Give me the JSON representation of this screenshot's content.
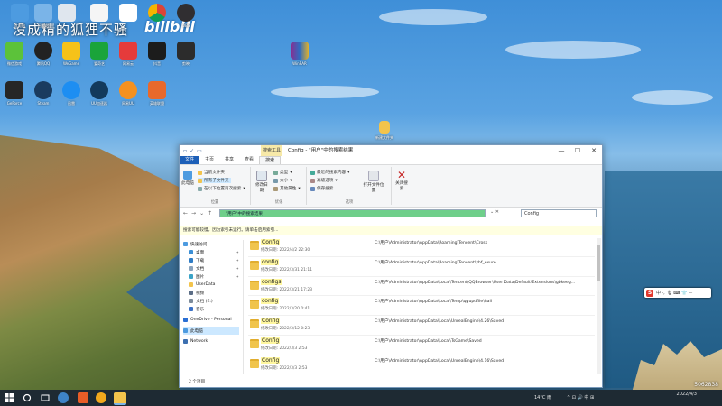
{
  "desktop": {
    "watermark": "没成精的狐狸不骚",
    "bilibili": "bilibili",
    "icons": [
      {
        "label": "此电脑"
      },
      {
        "label": "回收站"
      },
      {
        "label": ""
      },
      {
        "label": ""
      },
      {
        "label": ""
      },
      {
        "label": ""
      },
      {
        "label": "OBS"
      },
      {
        "label": "微信游戏"
      },
      {
        "label": "腾讯QQ"
      },
      {
        "label": "WeGame"
      },
      {
        "label": "爱奇艺"
      },
      {
        "label": "网易云"
      },
      {
        "label": "抖音"
      },
      {
        "label": "剪映"
      },
      {
        "label": "GeForce"
      },
      {
        "label": "Steam"
      },
      {
        "label": "迅雷"
      },
      {
        "label": "UU加速器"
      },
      {
        "label": "网易UU"
      },
      {
        "label": "英雄联盟"
      },
      {
        "label": "WinRAR"
      },
      {
        "label": "新建文件夹"
      }
    ]
  },
  "window": {
    "quick_access": [
      "▫",
      "✓",
      "▭"
    ],
    "context_tab": "搜索工具",
    "title": "Config - \"用户\"中的搜索结果",
    "controls": [
      "—",
      "☐",
      "✕"
    ],
    "tabs": [
      "文件",
      "主页",
      "共享",
      "查看",
      "搜索"
    ],
    "ribbon": {
      "btn_this_pc": "此电脑",
      "current_folder": "当前文件夹",
      "all_subfolders": "所有子文件夹",
      "search_again": "在以下位置再次搜索",
      "group_location": "位置",
      "btn_modified": "修改日期",
      "kind": "类型",
      "size": "大小",
      "other_props": "其他属性",
      "group_refine": "优化",
      "recent_searches": "最近的搜索内容",
      "advanced": "高级选项",
      "save_search": "保存搜索",
      "btn_open_location": "打开文件位置",
      "group_options": "选项",
      "btn_close_search": "关闭搜索"
    },
    "address": "\"用户\"中的搜索结果",
    "search_value": "Config",
    "info": "搜索可能较慢，因为索引未运行。请单击启用索引...",
    "nav": [
      {
        "label": "快速访问",
        "pin": false
      },
      {
        "label": "桌面",
        "pin": true
      },
      {
        "label": "下载",
        "pin": true
      },
      {
        "label": "文档",
        "pin": true
      },
      {
        "label": "图片",
        "pin": true
      },
      {
        "label": "UserData",
        "pin": false
      },
      {
        "label": "视频",
        "pin": false
      },
      {
        "label": "文档 (E:)",
        "pin": false
      },
      {
        "label": "音乐",
        "pin": false
      },
      {
        "label": "OneDrive - Personal",
        "pin": false
      },
      {
        "label": "此电脑",
        "pin": false,
        "selected": true
      },
      {
        "label": "Network",
        "pin": false
      }
    ],
    "results": [
      {
        "name": "Config",
        "date": "修改日期: 2022/4/2 22:30",
        "path": "C:\\用户\\Administrator\\AppData\\Roaming\\Tencent\\Cross"
      },
      {
        "name": "config",
        "date": "修改日期: 2022/3/31 21:11",
        "path": "C:\\用户\\Administrator\\AppData\\Roaming\\Tencent\\zhf_exure"
      },
      {
        "name": "configs",
        "date": "修改日期: 2022/3/21 17:23",
        "path": "C:\\用户\\Administrator\\AppData\\Local\\Tencent\\QQBrowser\\User Data\\Default\\Extensions\\gbkeeg..."
      },
      {
        "name": "config",
        "date": "修改日期: 2022/3/20 0:41",
        "path": "C:\\用户\\Administrator\\AppData\\Local\\Temp\\qgupdfile\\hall"
      },
      {
        "name": "Config",
        "date": "修改日期: 2022/3/12 0:23",
        "path": "C:\\用户\\Administrator\\AppData\\Local\\UnrealEngine\\4.26\\Saved"
      },
      {
        "name": "Config",
        "date": "修改日期: 2022/3/3 2:53",
        "path": "C:\\用户\\Administrator\\AppData\\Local\\TsGame\\Saved"
      },
      {
        "name": "Config",
        "date": "修改日期: 2022/3/3 2:53",
        "path": "C:\\用户\\Administrator\\AppData\\Local\\UnrealEngine\\4.16\\Saved"
      }
    ],
    "status": "2 个项目"
  },
  "ime": {
    "label": "中 ·, 🎙 ⌨ 👕 ⋯"
  },
  "taskbar": {
    "weather": "14°C 雨",
    "tray": "^ ⊡ 🔊 中 ⊞",
    "time": "",
    "date": "2022/4/3"
  },
  "stream_stat": "5062838"
}
